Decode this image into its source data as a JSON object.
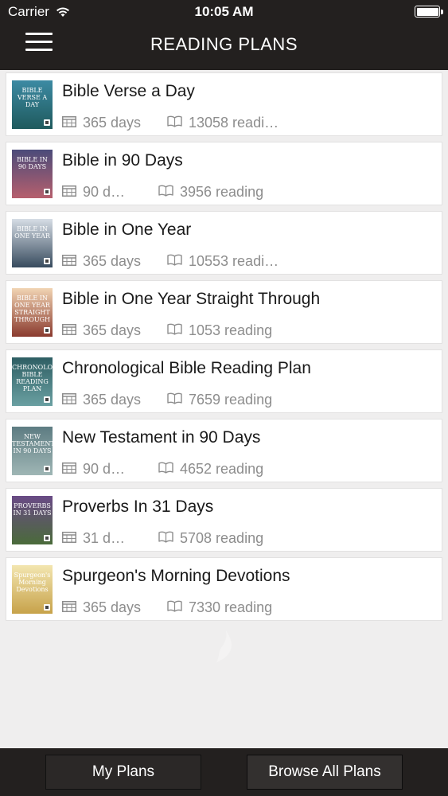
{
  "status_bar": {
    "carrier": "Carrier",
    "time": "10:05 AM"
  },
  "header": {
    "title": "READING PLANS"
  },
  "plans": [
    {
      "title": "Bible Verse a Day",
      "days": "365 days",
      "reading": "13058 readi…",
      "thumb_text": "BIBLE VERSE A DAY",
      "thumb_colors": [
        "#3c8aa3",
        "#1f5a5d"
      ]
    },
    {
      "title": "Bible in 90 Days",
      "days": "90 d…",
      "reading": "3956 reading",
      "thumb_text": "BIBLE IN 90 DAYS",
      "thumb_colors": [
        "#4b4b7a",
        "#b65f6d"
      ]
    },
    {
      "title": "Bible in One Year",
      "days": "365 days",
      "reading": "10553 readi…",
      "thumb_text": "BIBLE IN ONE YEAR",
      "thumb_colors": [
        "#d6dde5",
        "#374b5e"
      ]
    },
    {
      "title": "Bible in One Year Straight Through",
      "days": "365 days",
      "reading": "1053 reading",
      "thumb_text": "BIBLE IN ONE YEAR STRAIGHT THROUGH",
      "thumb_colors": [
        "#f1d4b3",
        "#8a3a2e"
      ]
    },
    {
      "title": "Chronological Bible Reading Plan",
      "days": "365 days",
      "reading": "7659 reading",
      "thumb_text": "CHRONOLOGICAL BIBLE READING PLAN",
      "thumb_colors": [
        "#2e5e63",
        "#6aa0a2"
      ]
    },
    {
      "title": "New Testament in 90 Days",
      "days": "90 d…",
      "reading": "4652 reading",
      "thumb_text": "NEW TESTAMENT IN 90 DAYS",
      "thumb_colors": [
        "#5d7c82",
        "#9fb6b5"
      ]
    },
    {
      "title": "Proverbs In 31 Days",
      "days": "31 d…",
      "reading": "5708 reading",
      "thumb_text": "PROVERBS IN 31 DAYS",
      "thumb_colors": [
        "#6a4a86",
        "#4a6b3a"
      ]
    },
    {
      "title": "Spurgeon's Morning Devotions",
      "days": "365 days",
      "reading": "7330 reading",
      "thumb_text": "Spurgeon's Morning Devotions",
      "thumb_colors": [
        "#f3e6b0",
        "#c7a24a"
      ]
    }
  ],
  "tabs": {
    "my_plans": "My Plans",
    "browse_all": "Browse All Plans"
  },
  "icons": {
    "days": "calendar-icon",
    "reading": "book-icon",
    "menu": "hamburger-icon"
  },
  "colors": {
    "bar": "#23201f",
    "background": "#efeeee",
    "meta_text": "#8d8d8d"
  }
}
